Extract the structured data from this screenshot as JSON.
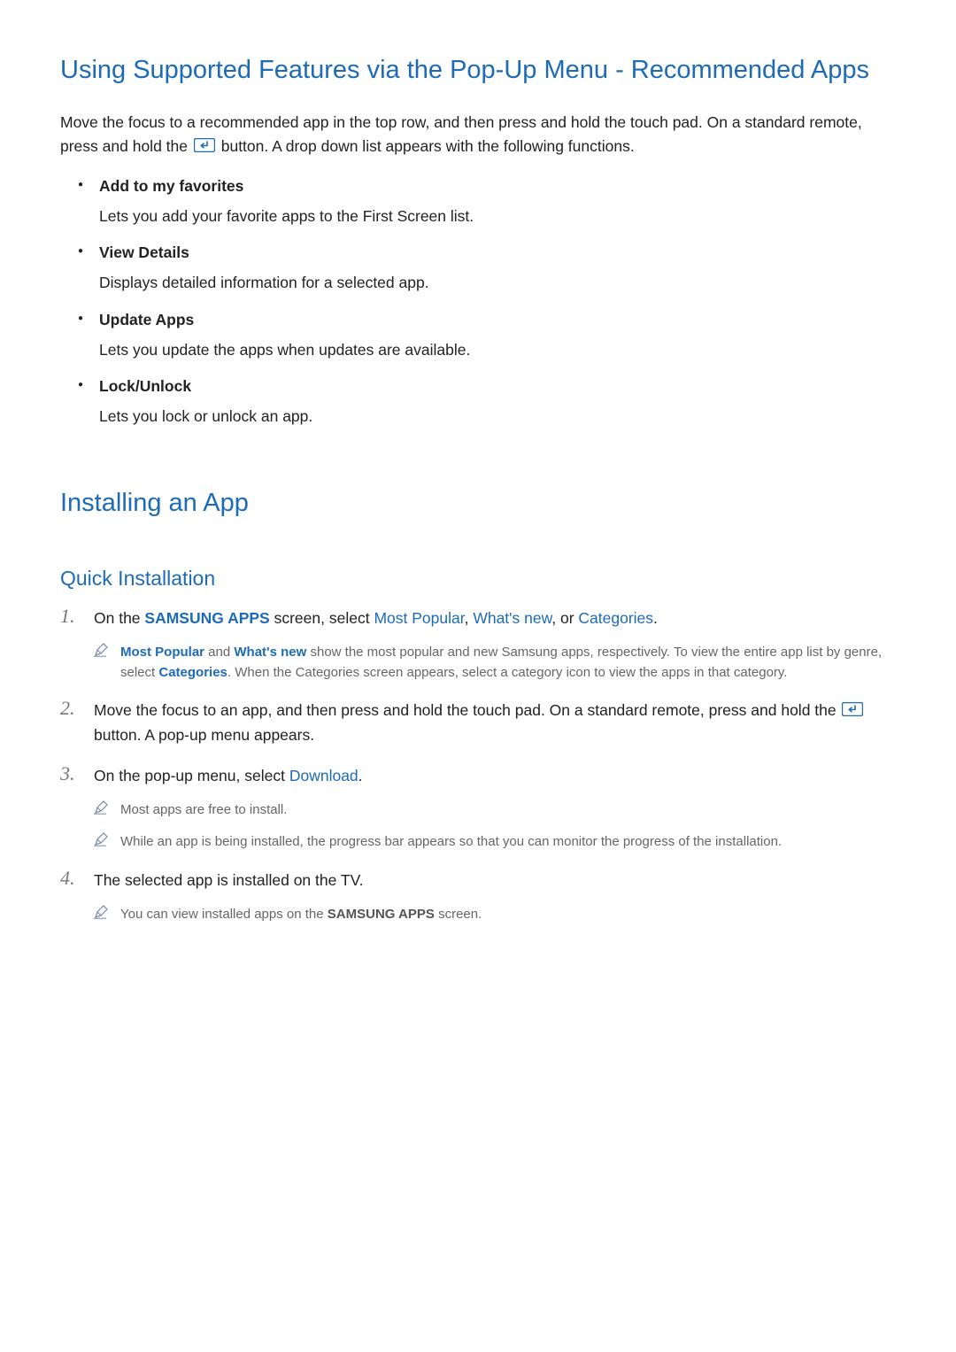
{
  "section1": {
    "heading": "Using Supported Features via the Pop-Up Menu - Recommended Apps",
    "intro_before": "Move the focus to a recommended app in the top row, and then press and hold the touch pad. On a standard remote, press and hold the ",
    "intro_after": " button. A drop down list appears with the following functions.",
    "items": [
      {
        "title": "Add to my favorites",
        "desc": "Lets you add your favorite apps to the First Screen list."
      },
      {
        "title": "View Details",
        "desc": "Displays detailed information for a selected app."
      },
      {
        "title": "Update Apps",
        "desc": "Lets you update the apps when updates are available."
      },
      {
        "title": "Lock/Unlock",
        "desc": "Lets you lock or unlock an app."
      }
    ]
  },
  "section2": {
    "heading": "Installing an App",
    "sub_heading": "Quick Installation",
    "steps": {
      "s1": {
        "prefix": "On the ",
        "hl1": "SAMSUNG APPS",
        "mid1": " screen, select ",
        "hl2": "Most Popular",
        "sep1": ", ",
        "hl3": "What's new",
        "sep2": ", or ",
        "hl4": "Categories",
        "suffix": ".",
        "note": {
          "hl1": "Most Popular",
          "t1": " and ",
          "hl2": "What's new",
          "t2": " show the most popular and new Samsung apps, respectively. To view the entire app list by genre, select ",
          "hl3": "Categories",
          "t3": ". When the Categories screen appears, select a category icon to view the apps in that category."
        }
      },
      "s2": {
        "before": "Move the focus to an app, and then press and hold the touch pad. On a standard remote, press and hold the ",
        "after": " button. A pop-up menu appears."
      },
      "s3": {
        "before": "On the pop-up menu, select ",
        "hl": "Download",
        "after": ".",
        "note1": "Most apps are free to install.",
        "note2": "While an app is being installed, the progress bar appears so that you can monitor the progress of the installation."
      },
      "s4": {
        "text": "The selected app is installed on the TV.",
        "note_before": "You can view installed apps on the ",
        "note_hl": "SAMSUNG APPS",
        "note_after": " screen."
      }
    }
  }
}
